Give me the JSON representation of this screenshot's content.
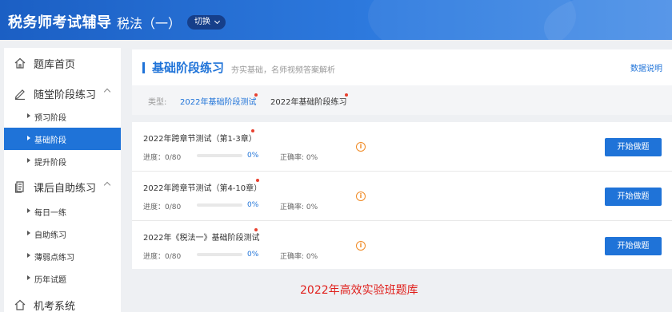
{
  "header": {
    "app_title": "税务师考试辅导",
    "subject": "税法（一）",
    "switch_label": "切换"
  },
  "sidebar": {
    "home": "题库首页",
    "group1": {
      "label": "随堂阶段练习",
      "items": [
        "预习阶段",
        "基础阶段",
        "提升阶段"
      ],
      "active_index": 1
    },
    "group2": {
      "label": "课后自助练习",
      "items": [
        "每日一练",
        "自助练习",
        "薄弱点练习",
        "历年试题"
      ]
    },
    "exam_system": "机考系统"
  },
  "main": {
    "title": "基础阶段练习",
    "description": "夯实基础，名师视频答案解析",
    "explain_link": "数据说明",
    "type_label": "类型:",
    "type_options": [
      "2022年基础阶段测试",
      "2022年基础阶段练习"
    ],
    "active_type_index": 0
  },
  "exercises": [
    {
      "title": "2022年跨章节测试（第1-3章）",
      "progress_label": "进度：",
      "progress_value": "0/80",
      "percent": "0%",
      "accuracy": "正确率: 0%",
      "progress_fraction": 0,
      "button": "开始做题"
    },
    {
      "title": "2022年跨章节测试（第4-10章）",
      "progress_label": "进度：",
      "progress_value": "0/80",
      "percent": "0%",
      "accuracy": "正确率: 0%",
      "progress_fraction": 0,
      "button": "开始做题"
    },
    {
      "title": "2022年《税法一》基础阶段测试",
      "progress_label": "进度：",
      "progress_value": "0/80",
      "percent": "0%",
      "accuracy": "正确率: 0%",
      "progress_fraction": 0,
      "button": "开始做题"
    }
  ],
  "footer_note": "2022年高效实验班题库",
  "colors": {
    "accent": "#1f73d8",
    "header_bg": "#2f7ce0",
    "dot": "#e8402f",
    "info": "#f08a24",
    "footer_note": "#e0201c"
  }
}
